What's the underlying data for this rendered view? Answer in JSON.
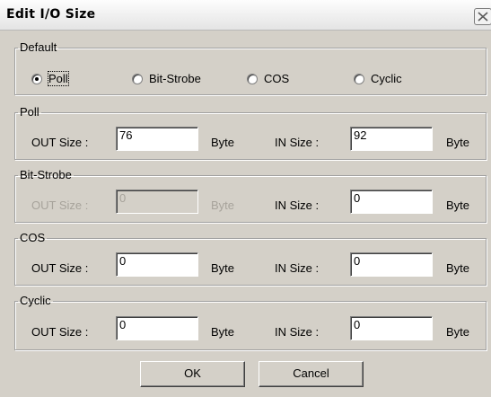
{
  "window": {
    "title": "Edit I/O Size",
    "close_icon": "close-icon"
  },
  "default_group": {
    "legend": "Default",
    "options": [
      {
        "label": "Poll",
        "checked": true
      },
      {
        "label": "Bit-Strobe",
        "checked": false
      },
      {
        "label": "COS",
        "checked": false
      },
      {
        "label": "Cyclic",
        "checked": false
      }
    ]
  },
  "poll": {
    "legend": "Poll",
    "out_label": "OUT Size :",
    "out_value": "76",
    "out_unit": "Byte",
    "in_label": "IN Size :",
    "in_value": "92",
    "in_unit": "Byte"
  },
  "bitstrobe": {
    "legend": "Bit-Strobe",
    "out_label": "OUT Size :",
    "out_value": "0",
    "out_unit": "Byte",
    "out_disabled": true,
    "in_label": "IN Size :",
    "in_value": "0",
    "in_unit": "Byte"
  },
  "cos": {
    "legend": "COS",
    "out_label": "OUT Size :",
    "out_value": "0",
    "out_unit": "Byte",
    "in_label": "IN Size :",
    "in_value": "0",
    "in_unit": "Byte"
  },
  "cyclic": {
    "legend": "Cyclic",
    "out_label": "OUT Size :",
    "out_value": "0",
    "out_unit": "Byte",
    "in_label": "IN Size :",
    "in_value": "0",
    "in_unit": "Byte"
  },
  "buttons": {
    "ok": "OK",
    "cancel": "Cancel"
  },
  "colors": {
    "dialog_bg": "#d4d0c8",
    "disabled_text": "#a7a39b",
    "field_bg": "#ffffff"
  }
}
